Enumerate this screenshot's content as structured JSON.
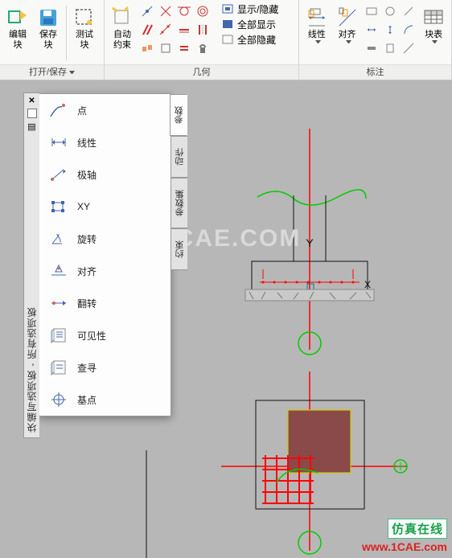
{
  "ribbon": {
    "group_open": {
      "title": "打开/保存",
      "edit": "编辑\n块",
      "save": "保存\n块",
      "test": "测试\n块"
    },
    "group_geo": {
      "title": "几何",
      "auto": "自动\n约束",
      "show_hide": "显示/隐藏",
      "show_all": "全部显示",
      "hide_all": "全部隐藏"
    },
    "group_dim": {
      "title": "标注",
      "linear": "线性",
      "align": "对齐",
      "block_table": "块表"
    }
  },
  "palette": {
    "title": "块编写选项板 - 所有选项板",
    "tabs": {
      "t1": "参数",
      "t2": "动作",
      "t3": "参数集",
      "t4": "约束"
    },
    "tools": {
      "point": "点",
      "linear": "线性",
      "polar": "极轴",
      "xy": "XY",
      "rotate": "旋转",
      "align": "对齐",
      "flip": "翻转",
      "visibility": "可见性",
      "lookup": "查寻",
      "basepoint": "基点"
    }
  },
  "branding": {
    "box": "仿真在线",
    "url": "www.1CAE.com"
  }
}
